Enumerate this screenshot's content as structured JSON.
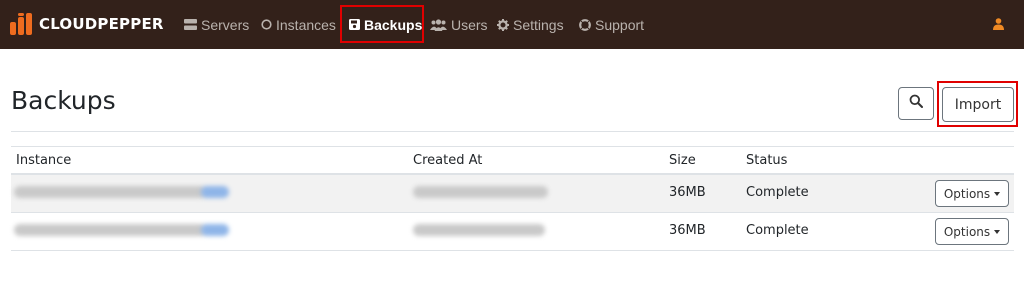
{
  "brand": {
    "name": "CLOUDPEPPER",
    "accent": "#ef6c1f"
  },
  "nav": {
    "items": [
      {
        "label": "Servers",
        "icon": "servers-icon"
      },
      {
        "label": "Instances",
        "icon": "circle-icon"
      },
      {
        "label": "Backups",
        "icon": "floppy-disk-icon",
        "active": true
      },
      {
        "label": "Users",
        "icon": "users-icon"
      },
      {
        "label": "Settings",
        "icon": "gear-icon"
      },
      {
        "label": "Support",
        "icon": "lifebuoy-icon"
      }
    ],
    "user_icon": "user-icon"
  },
  "page": {
    "title": "Backups",
    "search_icon": "search-icon",
    "import_label": "Import"
  },
  "table": {
    "columns": [
      "Instance",
      "Created At",
      "Size",
      "Status"
    ],
    "rows": [
      {
        "size": "36MB",
        "status": "Complete",
        "options_label": "Options"
      },
      {
        "size": "36MB",
        "status": "Complete",
        "options_label": "Options"
      }
    ]
  },
  "colors": {
    "navbar": "#33211a",
    "highlight": "#e00000"
  }
}
